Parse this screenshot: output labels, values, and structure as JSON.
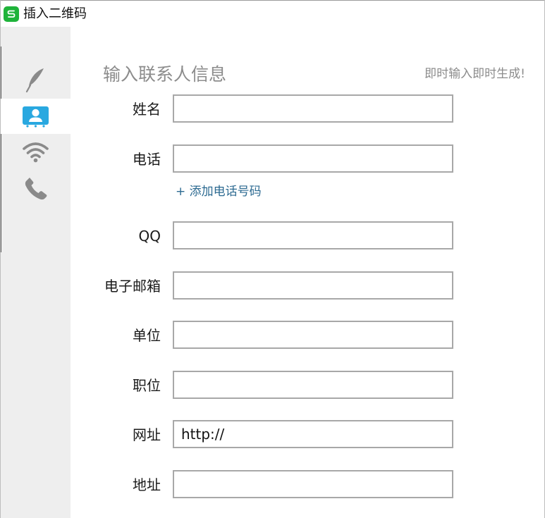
{
  "window": {
    "title": "插入二维码"
  },
  "sidebar": {
    "items": [
      {
        "name": "text",
        "icon": "feather-icon"
      },
      {
        "name": "contact",
        "icon": "contact-card-icon",
        "active": true
      },
      {
        "name": "wifi",
        "icon": "wifi-icon"
      },
      {
        "name": "phone",
        "icon": "phone-icon"
      }
    ]
  },
  "main": {
    "heading": "输入联系人信息",
    "tagline": "即时输入即时生成!",
    "add_phone_label": "+ 添加电话号码",
    "fields": [
      {
        "label": "姓名",
        "value": ""
      },
      {
        "label": "电话",
        "value": ""
      },
      {
        "label": "QQ",
        "value": ""
      },
      {
        "label": "电子邮箱",
        "value": ""
      },
      {
        "label": "单位",
        "value": ""
      },
      {
        "label": "职位",
        "value": ""
      },
      {
        "label": "网址",
        "value": "http://"
      },
      {
        "label": "地址",
        "value": ""
      }
    ]
  },
  "colors": {
    "app_icon": "#1fb33a",
    "sidebar_bg": "#eeeeee",
    "active_icon": "#29a8e0",
    "inactive_icon": "#8a8a8a",
    "link": "#2c6a91"
  }
}
